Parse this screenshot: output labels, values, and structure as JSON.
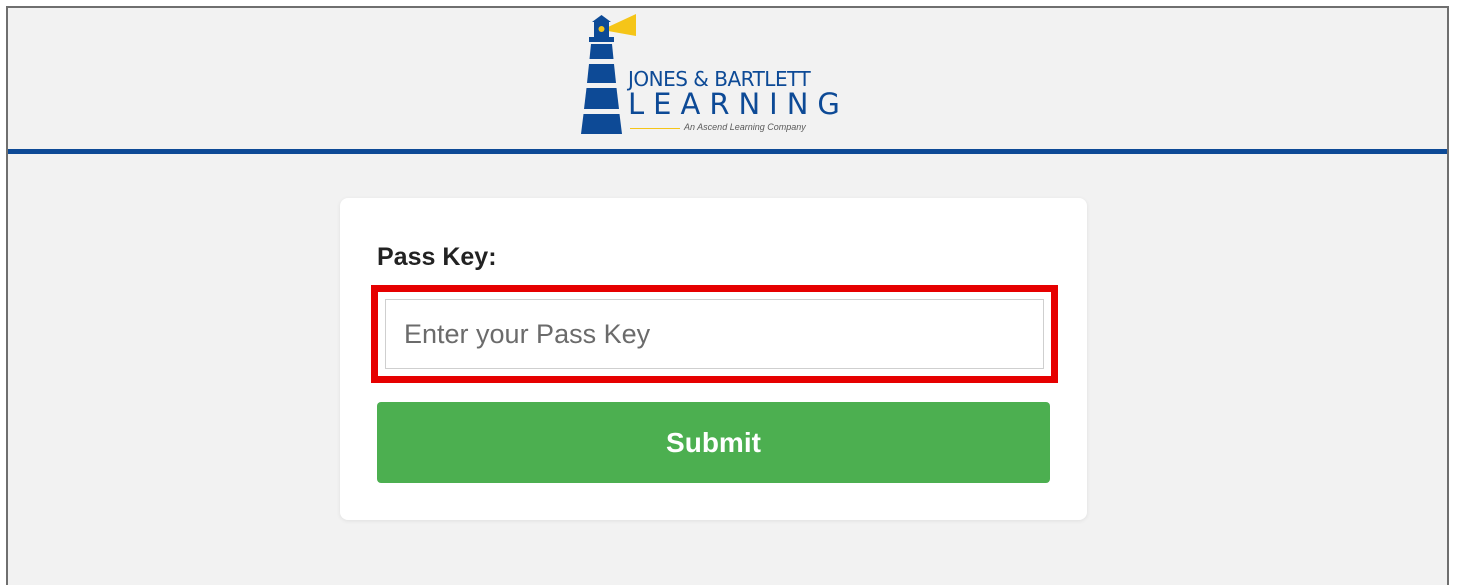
{
  "brand": {
    "name_top": "JONES & BARTLETT",
    "name_main": "LEARNING",
    "tagline": "An Ascend Learning Company",
    "logo_icon": "lighthouse-icon"
  },
  "form": {
    "label": "Pass Key:",
    "input": {
      "value": "",
      "placeholder": "Enter your Pass Key"
    },
    "submit_label": "Submit"
  },
  "colors": {
    "brand_blue": "#0d4a96",
    "brand_yellow": "#f5c518",
    "header_rule": "#0d4a96",
    "highlight": "#e60000",
    "button_green": "#4caf50",
    "page_bg": "#f2f2f2"
  }
}
